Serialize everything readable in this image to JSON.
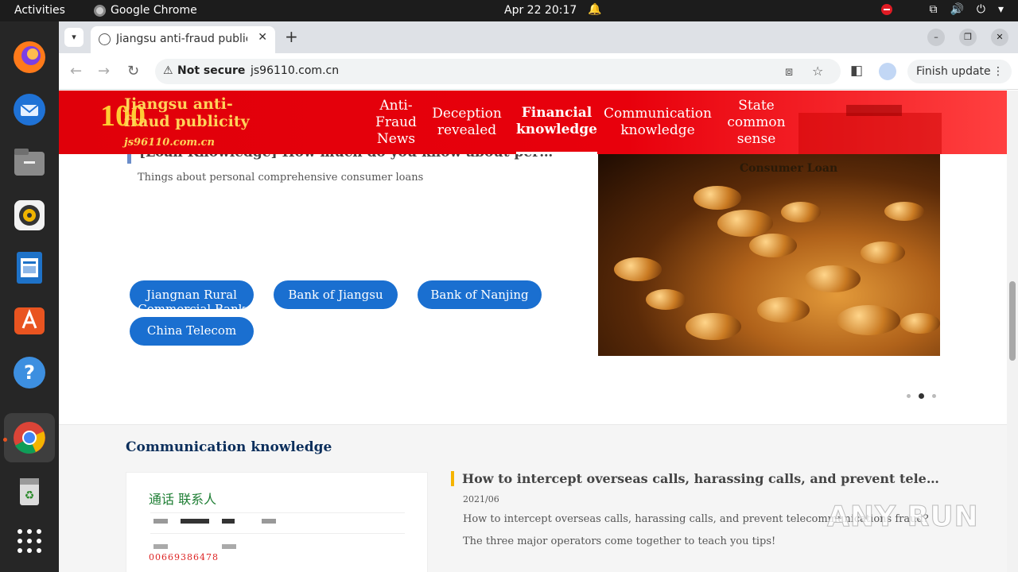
{
  "topbar": {
    "activities": "Activities",
    "app_name": "Google Chrome",
    "clock": "Apr 22  20:17"
  },
  "dock": {
    "apps": [
      "firefox-icon",
      "thunderbird-icon",
      "files-icon",
      "rhythmbox-icon",
      "libreoffice-writer-icon",
      "app-center-icon",
      "help-icon",
      "chrome-icon",
      "trash-icon",
      "show-apps-icon"
    ]
  },
  "browser": {
    "tab_title": "Jiangsu anti-fraud public",
    "security_label": "Not secure",
    "url": "js96110.com.cn",
    "finish_update": "Finish update"
  },
  "site": {
    "name": "Jiangsu anti-fraud publicity",
    "domain": "js96110.com.cn",
    "logo_number": "100",
    "nav": [
      {
        "label": "Anti-Fraud News"
      },
      {
        "label": "Deception revealed"
      },
      {
        "label": "Financial knowledge"
      },
      {
        "label": "Communication knowledge"
      },
      {
        "label": "State common sense"
      }
    ]
  },
  "loan": {
    "title": "[Loan Knowledge] How much do you know about personal comp...",
    "description": "Things about personal comprehensive consumer loans",
    "banks": [
      "Jiangnan Rural Commercial Bank",
      "Bank of Jiangsu",
      "Bank of Nanjing",
      "China Telecom"
    ],
    "carousel_caption": "Consumer Loan"
  },
  "communication": {
    "heading": "Communication knowledge",
    "article": {
      "title": "How to intercept overseas calls, harassing calls, and prevent telecommunica…",
      "date": "2021/06",
      "body": "How to intercept overseas calls, harassing calls, and prevent telecommunications fraud? The three major operators come together to teach you tips!"
    },
    "screenshot_text": {
      "tabs": "通话  联系人",
      "number": "00669386478"
    }
  },
  "watermark": "ANY RUN"
}
